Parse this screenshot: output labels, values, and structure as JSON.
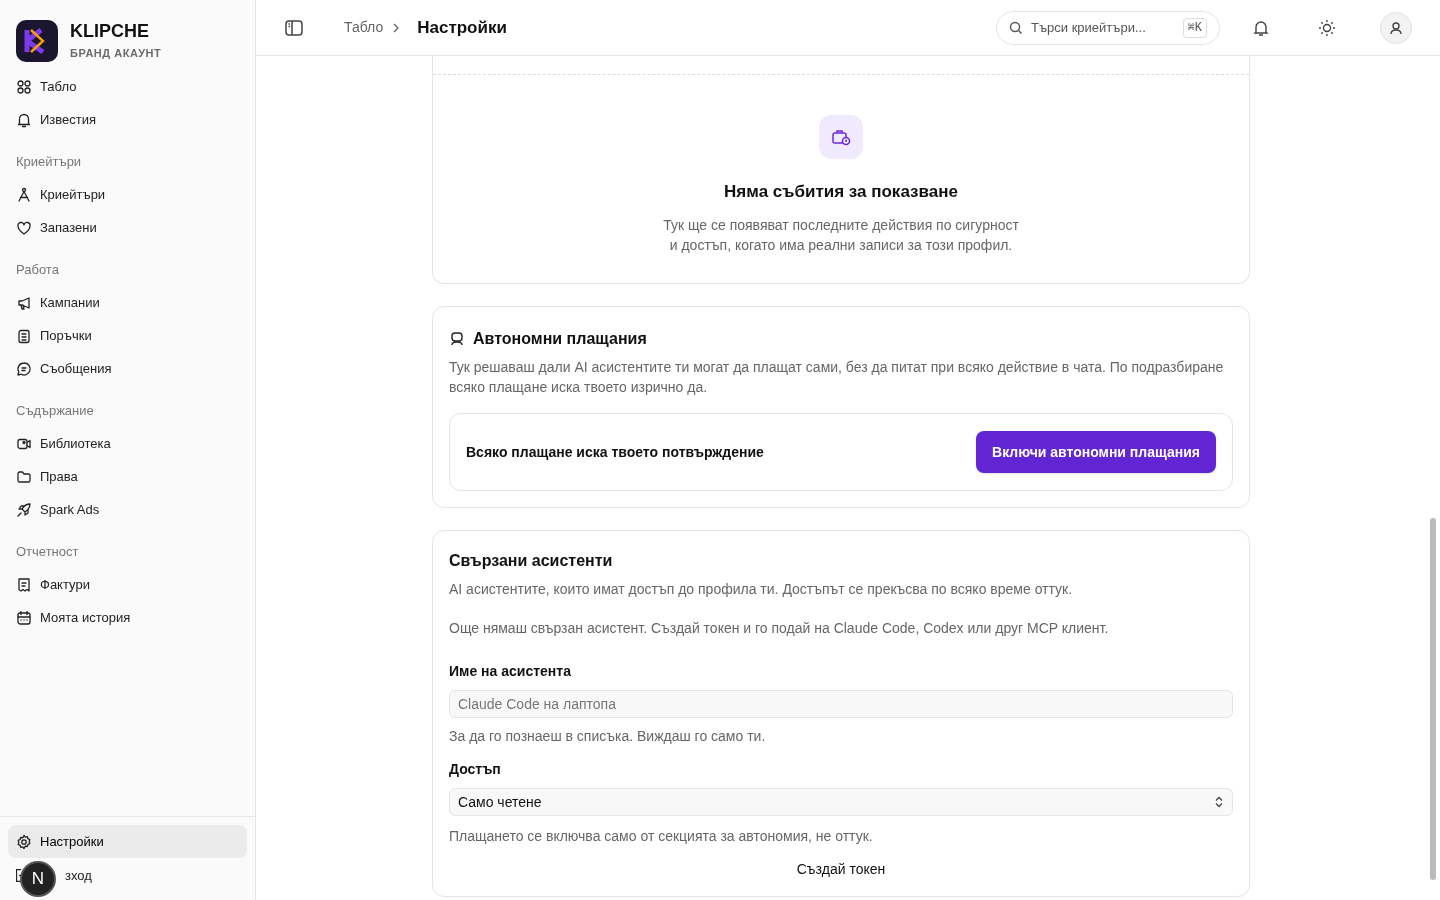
{
  "brand": {
    "name": "KLIPCHE",
    "subtitle": "БРАНД АКАУНТ"
  },
  "sidebar": {
    "groups": [
      {
        "items": [
          "Табло",
          "Известия"
        ]
      },
      {
        "heading": "Криейтъри",
        "items": [
          "Криейтъри",
          "Запазени"
        ]
      },
      {
        "heading": "Работа",
        "items": [
          "Кампании",
          "Поръчки",
          "Съобщения"
        ]
      },
      {
        "heading": "Съдържание",
        "items": [
          "Библиотека",
          "Права",
          "Spark Ads"
        ]
      },
      {
        "heading": "Отчетност",
        "items": [
          "Фактури",
          "Моята история"
        ]
      }
    ],
    "footer": [
      {
        "label": "Настройки",
        "selected": true
      },
      {
        "label": "зход",
        "selected": false
      }
    ],
    "badge": "N"
  },
  "header": {
    "breadcrumbs": [
      "Табло",
      "Настройки"
    ],
    "search": {
      "placeholder": "Търси криейтъри...",
      "shortcut": "⌘K"
    }
  },
  "events_card": {
    "title": "Няма събития за показване",
    "text": "Тук ще се появяват последните действия по сигурност\nи достъп, когато има реални записи за този профил."
  },
  "autonomy_card": {
    "title": "Автономни плащания",
    "text": "Тук решаваш дали AI асистентите ти могат да плащат сами, без да питат при всяко действие в чата. По подразбиране всяко плащане иска твоето изрично да.",
    "status": "Всяко плащане иска твоето потвърждение",
    "button": "Включи автономни плащания"
  },
  "assistants_card": {
    "title": "Свързани асистенти",
    "text": "AI асистентите, които имат достъп до профила ти. Достъпът се прекъсва по всяко време оттук.",
    "empty": "Още нямаш свързан асистент. Създай токен и го подай на Claude Code, Codex или друг MCP клиент.",
    "name_label": "Име на асистента",
    "name_placeholder": "Claude Code на лаптопа",
    "name_hint": "За да го познаеш в списъка. Виждаш го само ти.",
    "access_label": "Достъп",
    "access_value": "Само четене",
    "access_hint": "Плащането се включва само от секцията за автономия, не оттук.",
    "button": "Създай токен"
  }
}
